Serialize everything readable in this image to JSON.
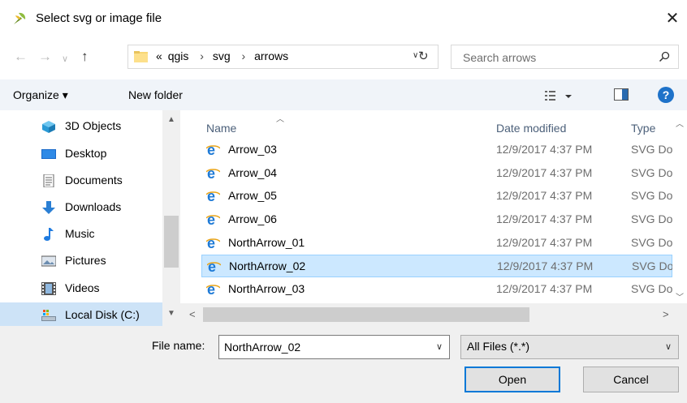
{
  "window": {
    "title": "Select svg or image file",
    "close_label": "✕"
  },
  "address": {
    "crumbs": [
      "qgis",
      "svg",
      "arrows"
    ],
    "overflow_label": "«",
    "search_placeholder": "Search arrows"
  },
  "toolbar": {
    "organize_label": "Organize ▾",
    "new_folder_label": "New folder",
    "help_label": "?"
  },
  "nav_pane": {
    "items": [
      {
        "label": "3D Objects",
        "icon": "3d-objects-icon"
      },
      {
        "label": "Desktop",
        "icon": "desktop-icon"
      },
      {
        "label": "Documents",
        "icon": "documents-icon"
      },
      {
        "label": "Downloads",
        "icon": "downloads-icon"
      },
      {
        "label": "Music",
        "icon": "music-icon"
      },
      {
        "label": "Pictures",
        "icon": "pictures-icon"
      },
      {
        "label": "Videos",
        "icon": "videos-icon"
      },
      {
        "label": "Local Disk (C:)",
        "icon": "local-disk-icon"
      }
    ]
  },
  "file_list": {
    "columns": {
      "name": "Name",
      "date": "Date modified",
      "type": "Type"
    },
    "rows": [
      {
        "name": "Arrow_03",
        "date": "12/9/2017 4:37 PM",
        "type": "SVG Document"
      },
      {
        "name": "Arrow_04",
        "date": "12/9/2017 4:37 PM",
        "type": "SVG Document"
      },
      {
        "name": "Arrow_05",
        "date": "12/9/2017 4:37 PM",
        "type": "SVG Document"
      },
      {
        "name": "Arrow_06",
        "date": "12/9/2017 4:37 PM",
        "type": "SVG Document"
      },
      {
        "name": "NorthArrow_01",
        "date": "12/9/2017 4:37 PM",
        "type": "SVG Document"
      },
      {
        "name": "NorthArrow_02",
        "date": "12/9/2017 4:37 PM",
        "type": "SVG Document",
        "selected": true
      },
      {
        "name": "NorthArrow_03",
        "date": "12/9/2017 4:37 PM",
        "type": "SVG Document"
      }
    ]
  },
  "footer": {
    "file_name_label": "File name:",
    "file_name_value": "NorthArrow_02",
    "file_type_value": "All Files (*.*)",
    "open_label": "Open",
    "cancel_label": "Cancel"
  },
  "colors": {
    "accent": "#0078d7",
    "selection": "#cce8ff",
    "toolbar_bg": "#f0f4f9",
    "help": "#1e72c9"
  }
}
